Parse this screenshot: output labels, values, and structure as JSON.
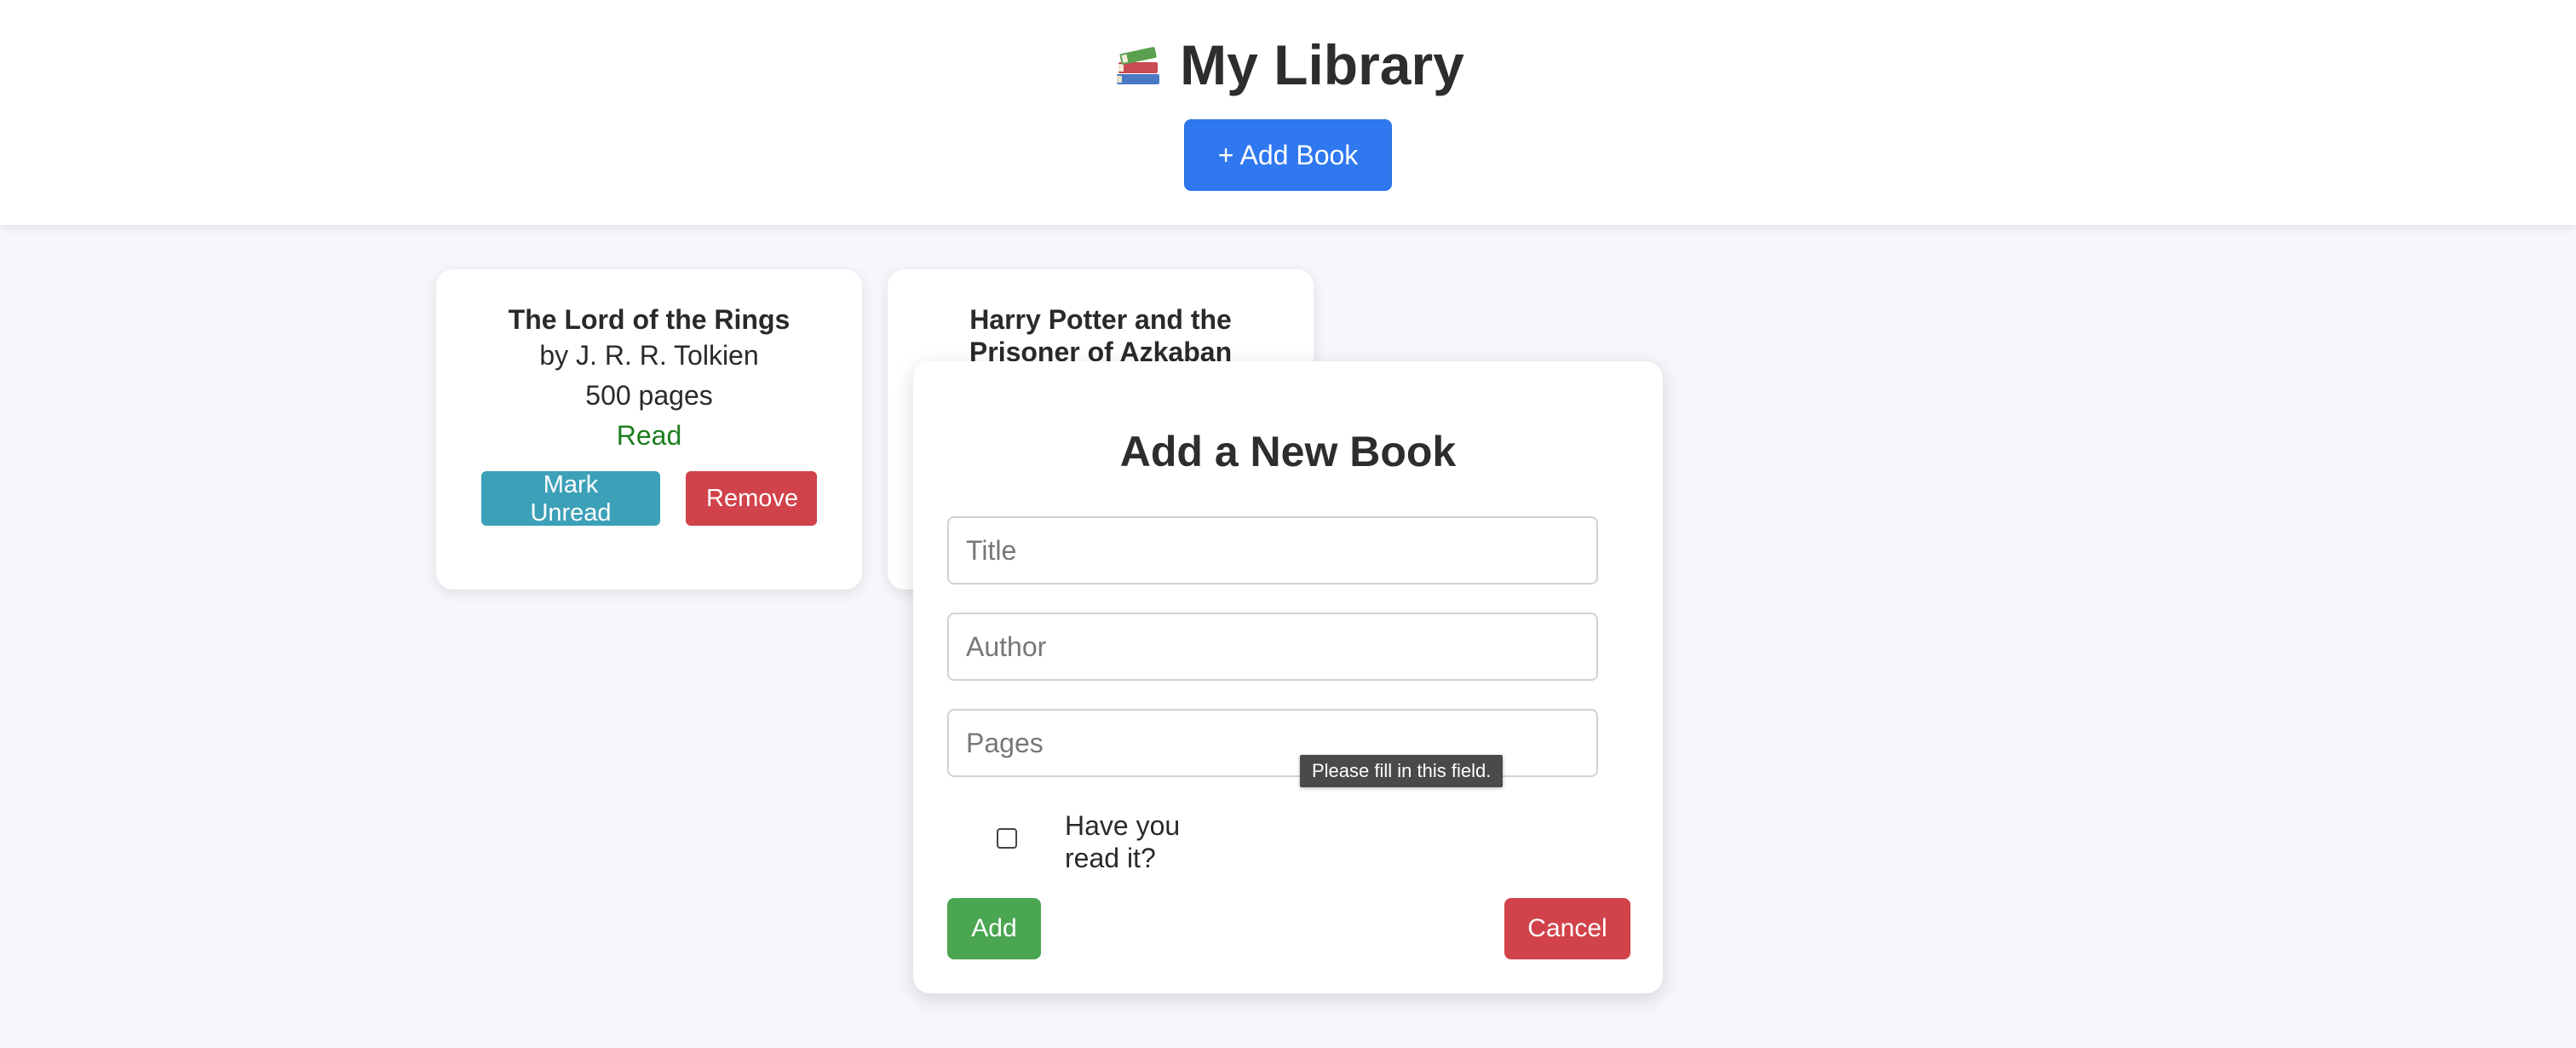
{
  "header": {
    "title": "My Library",
    "icon": "books-icon",
    "add_button": "+ Add Book"
  },
  "books": [
    {
      "title": "The Lord of the Rings",
      "author": "by J. R. R. Tolkien",
      "pages": "500 pages",
      "status": "Read",
      "toggle_label": "Mark Unread",
      "remove_label": "Remove"
    },
    {
      "title": "Harry Potter and the Prisoner of Azkaban"
    }
  ],
  "modal": {
    "title": "Add a New Book",
    "title_placeholder": "Title",
    "author_placeholder": "Author",
    "pages_placeholder": "Pages",
    "validation_tooltip": "Please fill in this field.",
    "read_label": "Have you read it?",
    "read_checked": false,
    "add_label": "Add",
    "cancel_label": "Cancel"
  },
  "colors": {
    "primary": "#2f78f0",
    "toggle": "#3ca0b8",
    "danger": "#d1424a",
    "success": "#4aa651",
    "read_status": "#1e7d1e"
  }
}
